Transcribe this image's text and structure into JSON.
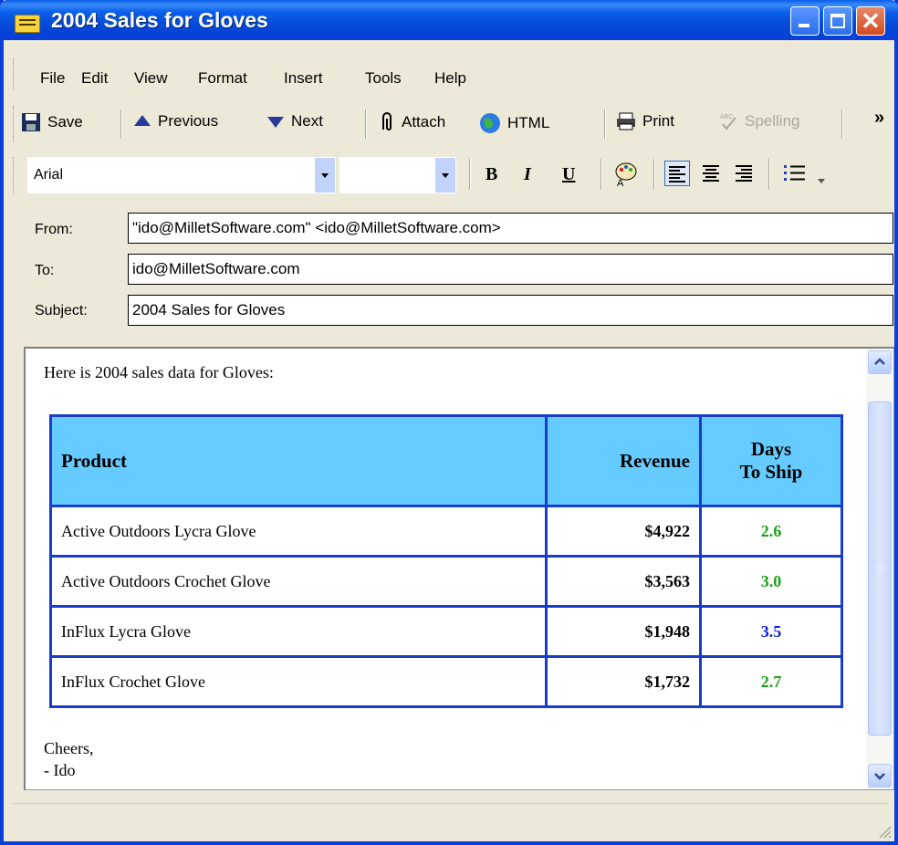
{
  "window": {
    "title": "2004 Sales for Gloves"
  },
  "menu": [
    "File",
    "Edit",
    "View",
    "Format",
    "Insert",
    "Tools",
    "Help"
  ],
  "toolbar": {
    "save": "Save",
    "previous": "Previous",
    "next": "Next",
    "attach": "Attach",
    "html": "HTML",
    "print": "Print",
    "spelling": "Spelling",
    "overflow": "»"
  },
  "format_bar": {
    "font": "Arial",
    "size": "",
    "bold": "B",
    "italic": "I",
    "underline": "U"
  },
  "header": {
    "from_label": "From:",
    "from_value": "\"ido@MilletSoftware.com\" <ido@MilletSoftware.com>",
    "to_label": "To:",
    "to_value": "ido@MilletSoftware.com",
    "subject_label": "Subject:",
    "subject_value": "2004 Sales for Gloves"
  },
  "message": {
    "intro": "Here is 2004 sales data for Gloves:",
    "columns": [
      "Product",
      "Revenue",
      "Days",
      "To Ship"
    ],
    "rows": [
      {
        "product": "Active Outdoors Lycra Glove",
        "revenue": "$4,922",
        "days": "2.6",
        "days_color": "#1aa11a"
      },
      {
        "product": "Active Outdoors Crochet Glove",
        "revenue": "$3,563",
        "days": "3.0",
        "days_color": "#1aa11a"
      },
      {
        "product": "InFlux Lycra Glove",
        "revenue": "$1,948",
        "days": "3.5",
        "days_color": "#1020e0"
      },
      {
        "product": "InFlux Crochet Glove",
        "revenue": "$1,732",
        "days": "2.7",
        "days_color": "#1aa11a"
      }
    ],
    "closing": "Cheers,",
    "signature": "- Ido"
  },
  "colors": {
    "table_header_bg": "#66ccff",
    "table_border": "#1a3ccc",
    "titlebar": "#0a5fe9"
  }
}
